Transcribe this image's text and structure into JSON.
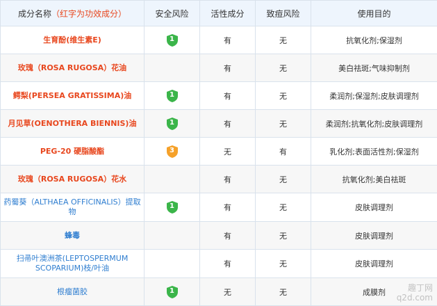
{
  "header": {
    "col_name": "成分名称",
    "col_name_note": "（红字为功效成分）",
    "col_safety": "安全风险",
    "col_active": "活性成分",
    "col_acne": "致痘风险",
    "col_purpose": "使用目的"
  },
  "colors": {
    "green_badge": "#3bb54a",
    "orange_badge": "#f5a12a",
    "red_text": "#e8471e",
    "blue_text": "#2f7ed0"
  },
  "rows": [
    {
      "name": "生育酚(维生素E)",
      "safety": "1",
      "active": "有",
      "acne": "无",
      "purpose": "抗氧化剂;保湿剂"
    },
    {
      "name": "玫瑰（ROSA RUGOSA）花油",
      "safety": "",
      "active": "有",
      "acne": "无",
      "purpose": "美白祛斑;气味抑制剂"
    },
    {
      "name": "鳄梨(PERSEA GRATISSIMA)油",
      "safety": "1",
      "active": "有",
      "acne": "无",
      "purpose": "柔润剂;保湿剂;皮肤调理剂"
    },
    {
      "name": "月见草(OENOTHERA BIENNIS)油",
      "safety": "1",
      "active": "有",
      "acne": "无",
      "purpose": "柔润剂;抗氧化剂;皮肤调理剂"
    },
    {
      "name": "PEG-20 硬脂酸酯",
      "safety": "3",
      "active": "无",
      "acne": "有",
      "purpose": "乳化剂;表面活性剂;保湿剂"
    },
    {
      "name": "玫瑰（ROSA RUGOSA）花水",
      "safety": "",
      "active": "有",
      "acne": "无",
      "purpose": "抗氧化剂;美白祛斑"
    },
    {
      "name": "药蜀葵（ALTHAEA OFFICINALIS）提取物",
      "safety": "1",
      "active": "有",
      "acne": "无",
      "purpose": "皮肤调理剂"
    },
    {
      "name": "蜂毒",
      "safety": "",
      "active": "有",
      "acne": "无",
      "purpose": "皮肤调理剂"
    },
    {
      "name": "扫帚叶澳洲茶(LEPTOSPERMUM SCOPARIUM)枝/叶油",
      "safety": "",
      "active": "有",
      "acne": "无",
      "purpose": "皮肤调理剂"
    },
    {
      "name": "根瘤菌胶",
      "safety": "1",
      "active": "无",
      "acne": "无",
      "purpose": "成膜剂"
    }
  ],
  "watermark": {
    "line1": "趣丁网",
    "line2": "q2d.com"
  }
}
